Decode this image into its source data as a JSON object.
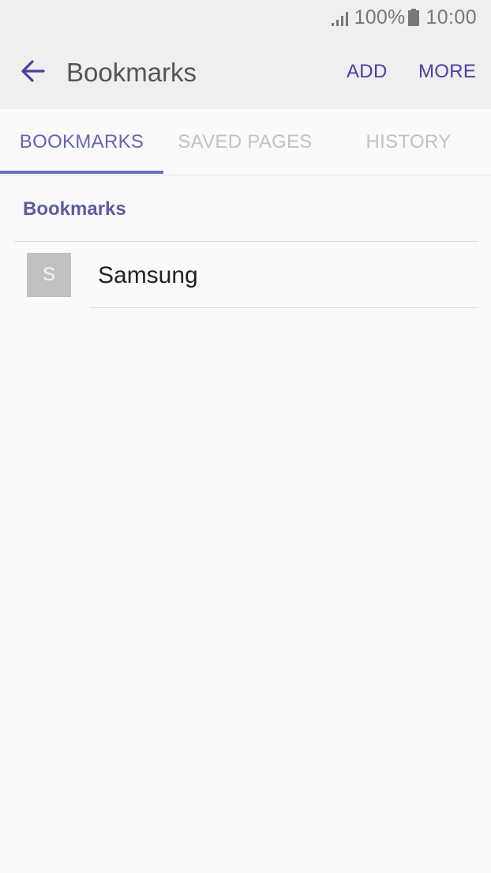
{
  "status_bar": {
    "battery_percent": "100%",
    "time": "10:00",
    "icons": [
      "signal-icon",
      "battery-icon"
    ]
  },
  "toolbar": {
    "back_icon": "arrow-left-icon",
    "title": "Bookmarks",
    "add_label": "ADD",
    "more_label": "MORE"
  },
  "tabs": [
    {
      "label": "BOOKMARKS",
      "active": true
    },
    {
      "label": "SAVED PAGES",
      "active": false
    },
    {
      "label": "HISTORY",
      "active": false
    }
  ],
  "section": {
    "header": "Bookmarks"
  },
  "bookmarks": [
    {
      "initial": "S",
      "title": "Samsung"
    }
  ],
  "colors": {
    "accent": "#4b3fa0",
    "tab_active": "#6266b0",
    "tab_inactive": "#c2c2c2",
    "toolbar_bg": "#efefef",
    "content_bg": "#fafafa",
    "favicon_bg": "#c1c1c1"
  }
}
